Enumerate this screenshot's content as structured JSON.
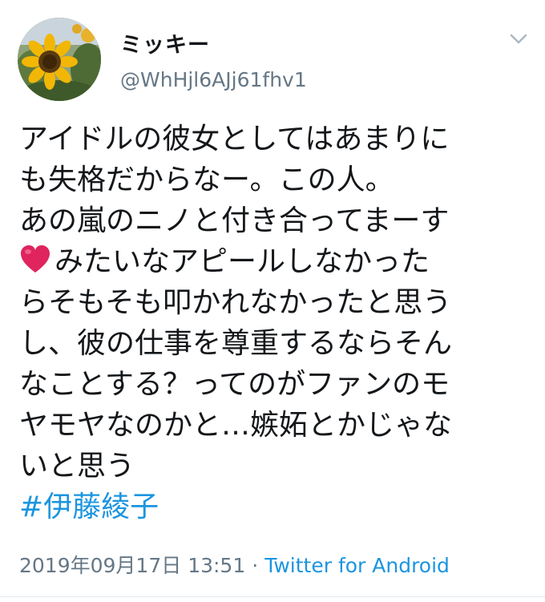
{
  "user": {
    "display_name": "ミッキー",
    "handle": "@WhHjl6AJj61fhv1"
  },
  "tweet": {
    "lines": [
      "アイドルの彼女としてはあまりに",
      "も失格だからなー。この人。",
      "あの嵐のニノと付き合ってまーす",
      "みたいなアピールしなかった",
      "らそもそも叩かれなかったと思う",
      "し、彼の仕事を尊重するならそん",
      "なことする？ってのがファンのモ",
      "ヤモヤなのかと…嫉妬とかじゃな",
      "いと思う"
    ],
    "hashtag": "#伊藤綾子"
  },
  "meta": {
    "timestamp": "2019年09月17日 13:51",
    "separator": "·",
    "source": "Twitter for Android"
  },
  "icons": {
    "avatar": "sunflower-avatar",
    "menu": "chevron-down-icon",
    "heart": "red-heart-emoji"
  },
  "colors": {
    "text": "#14171a",
    "secondary": "#657786",
    "link": "#1b95e0",
    "heart": "#e0245e"
  }
}
